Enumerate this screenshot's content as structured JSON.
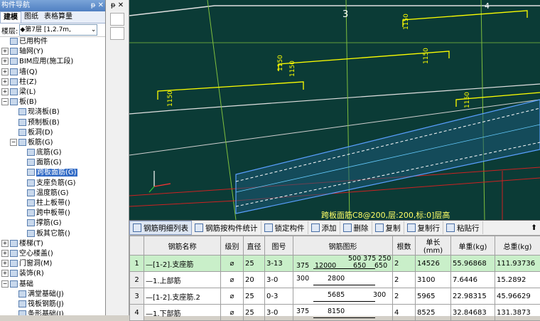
{
  "nav": {
    "title": "构件导航",
    "pin": "ᵽ ✕",
    "tabs": [
      "建模",
      "图纸",
      "表格算量"
    ],
    "floor_label": "楼层:",
    "floor_value": "第7层 [1,2.7m,"
  },
  "tree": [
    {
      "level": 0,
      "toggle": "",
      "label": "已用构件"
    },
    {
      "level": 0,
      "toggle": "+",
      "label": "轴网(Y)"
    },
    {
      "level": 0,
      "toggle": "+",
      "label": "BIM应用(施工段)"
    },
    {
      "level": 0,
      "toggle": "+",
      "label": "墙(Q)"
    },
    {
      "level": 0,
      "toggle": "+",
      "label": "柱(Z)"
    },
    {
      "level": 0,
      "toggle": "+",
      "label": "梁(L)"
    },
    {
      "level": 0,
      "toggle": "−",
      "label": "板(B)"
    },
    {
      "level": 1,
      "toggle": "",
      "label": "现浇板(B)"
    },
    {
      "level": 1,
      "toggle": "",
      "label": "预制板(B)"
    },
    {
      "level": 1,
      "toggle": "",
      "label": "板洞(D)"
    },
    {
      "level": 1,
      "toggle": "−",
      "label": "板筋(G)"
    },
    {
      "level": 2,
      "toggle": "",
      "label": "底筋(G)"
    },
    {
      "level": 2,
      "toggle": "",
      "label": "面筋(G)"
    },
    {
      "level": 2,
      "toggle": "",
      "label": "跨板面筋(G)",
      "selected": true
    },
    {
      "level": 2,
      "toggle": "",
      "label": "支座负筋(G)"
    },
    {
      "level": 2,
      "toggle": "",
      "label": "温度筋(G)"
    },
    {
      "level": 2,
      "toggle": "",
      "label": "柱上板带()"
    },
    {
      "level": 2,
      "toggle": "",
      "label": "跨中板带()"
    },
    {
      "level": 2,
      "toggle": "",
      "label": "撑筋(G)"
    },
    {
      "level": 2,
      "toggle": "",
      "label": "板其它筋()"
    },
    {
      "level": 0,
      "toggle": "+",
      "label": "楼梯(T)"
    },
    {
      "level": 0,
      "toggle": "+",
      "label": "空心楼盖()"
    },
    {
      "level": 0,
      "toggle": "+",
      "label": "门窗洞(M)"
    },
    {
      "level": 0,
      "toggle": "+",
      "label": "装饰(R)"
    },
    {
      "level": 0,
      "toggle": "−",
      "label": "基础"
    },
    {
      "level": 1,
      "toggle": "",
      "label": "满堂基础(J)"
    },
    {
      "level": 1,
      "toggle": "",
      "label": "筏板钢筋(J)"
    },
    {
      "level": 1,
      "toggle": "",
      "label": "条形基础(J)"
    }
  ],
  "midbar": {
    "title": "ᵽ ✕"
  },
  "cad": {
    "labels": [
      "3",
      "4",
      "1150",
      "1150",
      "1150",
      "1150",
      "1150",
      "1150"
    ],
    "status": "跨板面筋C8@200,层:200,标:0]层高"
  },
  "toolbar": [
    "钢筋明细列表",
    "钢筋按构件统计",
    "锁定构件",
    "添加",
    "删除",
    "复制",
    "复制行",
    "粘贴行"
  ],
  "table": {
    "headers": [
      "",
      "钢筋名称",
      "级别",
      "直径",
      "图号",
      "钢筋图形",
      "根数",
      "单长(mm)",
      "单重(kg)",
      "总重(kg)"
    ],
    "rows": [
      {
        "no": "1",
        "name": "—[1-2].支座筋",
        "grade": "⌀",
        "dia": "25",
        "fig": "3-13",
        "shape": [
          "500 375 250",
          "375",
          "12000",
          "650",
          "650"
        ],
        "count": "2",
        "len": "14526",
        "unit": "55.96868",
        "total": "111.93736"
      },
      {
        "no": "2",
        "name": "—1.上部筋",
        "grade": "⌀",
        "dia": "20",
        "fig": "3-0",
        "shape": [
          "300",
          "2800"
        ],
        "count": "2",
        "len": "3100",
        "unit": "7.6446",
        "total": "15.2892"
      },
      {
        "no": "3",
        "name": "—[1-2].支座筋.2",
        "grade": "⌀",
        "dia": "25",
        "fig": "0-3",
        "shape": [
          "5685",
          "300"
        ],
        "count": "2",
        "len": "5965",
        "unit": "22.98315",
        "total": "45.96629"
      },
      {
        "no": "4",
        "name": "—1.下部筋",
        "grade": "⌀",
        "dia": "25",
        "fig": "3-0",
        "shape": [
          "375",
          "8150"
        ],
        "count": "4",
        "len": "8525",
        "unit": "32.84683",
        "total": "131.3873"
      }
    ]
  },
  "colors": {
    "cad_bg": "#0b3b36",
    "selection": "#316ac5",
    "row_highlight": "#c9efc9"
  }
}
